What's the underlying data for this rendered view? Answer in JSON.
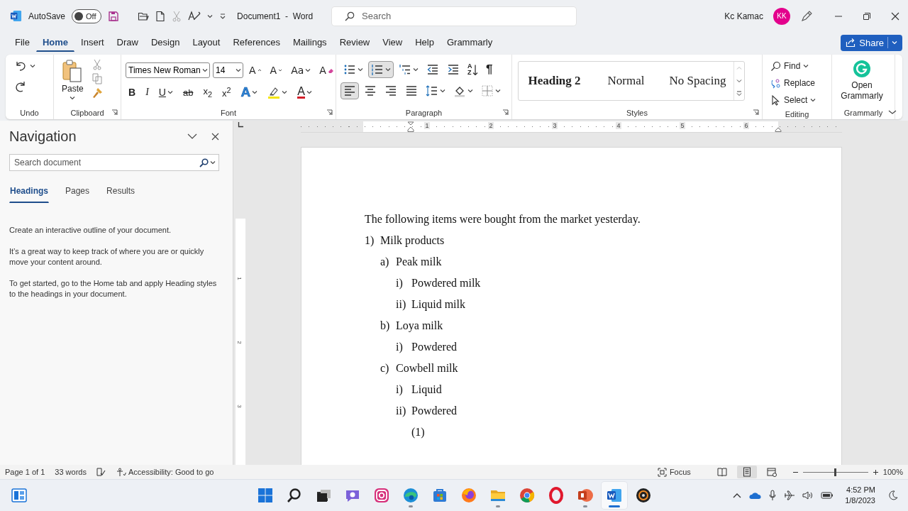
{
  "title_bar": {
    "autosave_label": "AutoSave",
    "autosave": {
      "label": "Off",
      "on": false
    },
    "document_title": "Document1  -  Word",
    "search": {
      "placeholder": "Search"
    },
    "user_name": "Kc Kamac",
    "user_initials": "KK"
  },
  "menu_tabs": [
    {
      "label": "File",
      "selected": false
    },
    {
      "label": "Home",
      "selected": true
    },
    {
      "label": "Insert",
      "selected": false
    },
    {
      "label": "Draw",
      "selected": false
    },
    {
      "label": "Design",
      "selected": false
    },
    {
      "label": "Layout",
      "selected": false
    },
    {
      "label": "References",
      "selected": false
    },
    {
      "label": "Mailings",
      "selected": false
    },
    {
      "label": "Review",
      "selected": false
    },
    {
      "label": "View",
      "selected": false
    },
    {
      "label": "Help",
      "selected": false
    },
    {
      "label": "Grammarly",
      "selected": false
    }
  ],
  "share_button": "Share",
  "ribbon": {
    "undo": {
      "label": "Undo"
    },
    "clipboard": {
      "label": "Clipboard",
      "paste": "Paste"
    },
    "font": {
      "label": "Font",
      "font_name": "Times New Roman",
      "font_size": "14",
      "top_buttons": [
        {
          "kind": "grow_font",
          "label": "A"
        },
        {
          "kind": "shrink_font",
          "label": "A"
        },
        {
          "kind": "change_case",
          "label": "Aa"
        },
        {
          "kind": "clear_formatting",
          "label": "A"
        }
      ],
      "format_buttons": [
        {
          "kind": "bold",
          "label": "B"
        },
        {
          "kind": "italic",
          "label": "I"
        },
        {
          "kind": "underline",
          "label": "U"
        },
        {
          "kind": "strikethrough",
          "label": "ab"
        },
        {
          "kind": "subscript",
          "label": "x$_{2}$"
        },
        {
          "kind": "superscript",
          "label": "x$^{2}$"
        },
        {
          "kind": "text_effects",
          "label": "A"
        },
        {
          "kind": "highlight"
        },
        {
          "kind": "font_color",
          "label": "A"
        }
      ]
    },
    "paragraph": {
      "label": "Paragraph",
      "buttons": [
        {
          "kind": "bullets",
          "selected": false
        },
        {
          "kind": "numbering",
          "selected": true
        },
        {
          "kind": "multilevel",
          "selected": false
        },
        {
          "kind": "decrease_indent",
          "selected": false
        },
        {
          "kind": "increase_indent",
          "selected": false
        },
        {
          "kind": "sort",
          "label": "AZ",
          "selected": false
        },
        {
          "kind": "marks",
          "label": "¶",
          "selected": false
        },
        {
          "kind": "align_left",
          "selected": true
        },
        {
          "kind": "center",
          "selected": false
        },
        {
          "kind": "align_right",
          "selected": false
        },
        {
          "kind": "justify",
          "selected": false
        },
        {
          "kind": "line_spacing",
          "selected": false
        },
        {
          "kind": "shading",
          "selected": false
        },
        {
          "kind": "borders",
          "selected": false
        }
      ]
    },
    "styles": {
      "label": "Styles",
      "items": [
        {
          "label": "Heading 2",
          "kind": "heading"
        },
        {
          "label": "Normal",
          "kind": "normal"
        },
        {
          "label": "No Spacing",
          "kind": "normal"
        }
      ]
    },
    "editing": {
      "label": "Editing",
      "commands": [
        {
          "kind": "find",
          "label": "Find"
        },
        {
          "kind": "replace",
          "label": "Replace"
        },
        {
          "kind": "select",
          "label": "Select"
        }
      ]
    },
    "grammarly": {
      "label": "Grammarly",
      "button": "Open Grammarly"
    }
  },
  "navigation": {
    "title": "Navigation",
    "search": {
      "placeholder": "Search document"
    },
    "tabs": [
      {
        "label": "Headings",
        "selected": true
      },
      {
        "label": "Pages",
        "selected": false
      },
      {
        "label": "Results",
        "selected": false
      }
    ],
    "paragraphs": [
      "Create an interactive outline of your document.",
      "It’s a great way to keep track of where you are or quickly move your content around.",
      "To get started, go to the Home tab and apply Heading styles to the headings in your document."
    ]
  },
  "ruler": {
    "labels": [
      "1",
      "2",
      "3",
      "4",
      "5",
      "6"
    ]
  },
  "vertical_ruler": {
    "labels": [
      "1",
      "2",
      "3"
    ]
  },
  "document": {
    "paragraph": "The following items were bought from the market yesterday.",
    "list": [
      {
        "marker": "1)",
        "text": "Milk products",
        "children": [
          {
            "marker": "a)",
            "text": "Peak milk",
            "children": [
              {
                "marker": "i)",
                "text": "Powdered milk"
              },
              {
                "marker": "ii)",
                "text": "Liquid milk"
              }
            ]
          },
          {
            "marker": "b)",
            "text": "Loya milk",
            "children": [
              {
                "marker": "i)",
                "text": "Powdered"
              }
            ]
          },
          {
            "marker": "c)",
            "text": "Cowbell milk",
            "children": [
              {
                "marker": "i)",
                "text": "Liquid"
              },
              {
                "marker": "ii)",
                "text": "Powdered",
                "children": [
                  {
                    "marker": "(1)"
                  }
                ]
              }
            ]
          }
        ]
      }
    ]
  },
  "status_bar": {
    "page": "Page 1 of 1",
    "words": "33 words",
    "accessibility": "Accessibility: Good to go",
    "focus": "Focus",
    "view_buttons": [
      {
        "kind": "read",
        "selected": false
      },
      {
        "kind": "print",
        "selected": true
      },
      {
        "kind": "web",
        "selected": false
      }
    ],
    "zoom": {
      "level": 0.5,
      "reading": "100%"
    }
  },
  "taskbar": {
    "apps": [
      {
        "kind": "start",
        "running": false,
        "active": false
      },
      {
        "kind": "search",
        "running": false,
        "active": false
      },
      {
        "kind": "task_view",
        "running": false,
        "active": false
      },
      {
        "kind": "chat",
        "running": false,
        "active": false
      },
      {
        "kind": "camera",
        "running": false,
        "active": false
      },
      {
        "kind": "swirl",
        "running": true,
        "active": false
      },
      {
        "kind": "store",
        "running": false,
        "active": false
      },
      {
        "kind": "fox",
        "running": false,
        "active": false
      },
      {
        "kind": "folder",
        "running": true,
        "active": false
      },
      {
        "kind": "wheel",
        "running": false,
        "active": false
      },
      {
        "kind": "ring",
        "running": false,
        "active": false
      },
      {
        "kind": "slides",
        "running": true,
        "active": false
      },
      {
        "kind": "doc",
        "running": true,
        "active": true
      },
      {
        "kind": "disc",
        "running": false,
        "active": false
      }
    ],
    "time": "4:52 PM",
    "date": "1/8/2023"
  }
}
